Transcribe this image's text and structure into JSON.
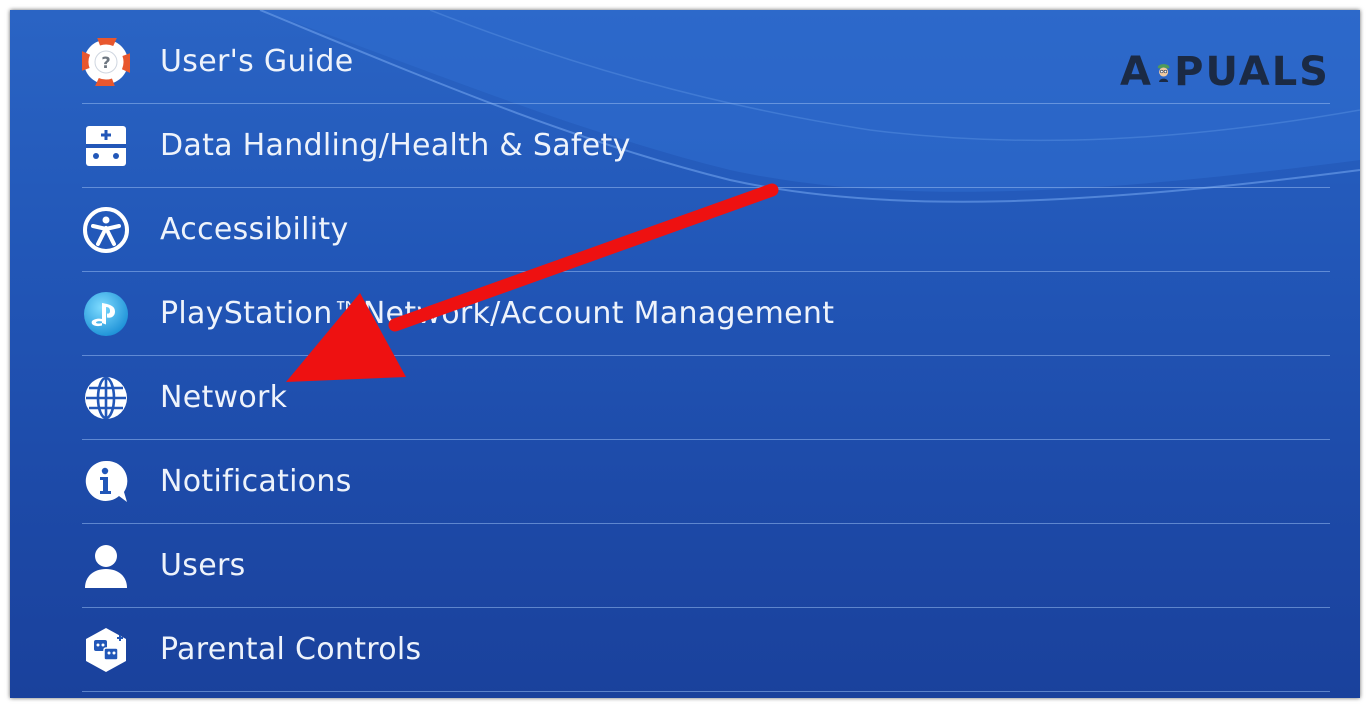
{
  "menu": {
    "items": [
      {
        "label": "User's Guide",
        "icon": "lifebuoy-help-icon"
      },
      {
        "label": "Data Handling/Health & Safety",
        "icon": "data-handling-icon"
      },
      {
        "label": "Accessibility",
        "icon": "accessibility-icon"
      },
      {
        "label": "PlayStation™Network/Account Management",
        "icon": "playstation-network-icon"
      },
      {
        "label": "Network",
        "icon": "globe-icon"
      },
      {
        "label": "Notifications",
        "icon": "info-bubble-icon"
      },
      {
        "label": "Users",
        "icon": "user-icon"
      },
      {
        "label": "Parental Controls",
        "icon": "parental-controls-icon"
      }
    ]
  },
  "watermark": {
    "left": "A",
    "right": "PUALS"
  },
  "annotation": {
    "type": "arrow",
    "color": "#ee1111",
    "points_to": "Network"
  },
  "colors": {
    "background": "#2257b8",
    "divider": "#96b9f0",
    "label": "#eef3fb"
  }
}
